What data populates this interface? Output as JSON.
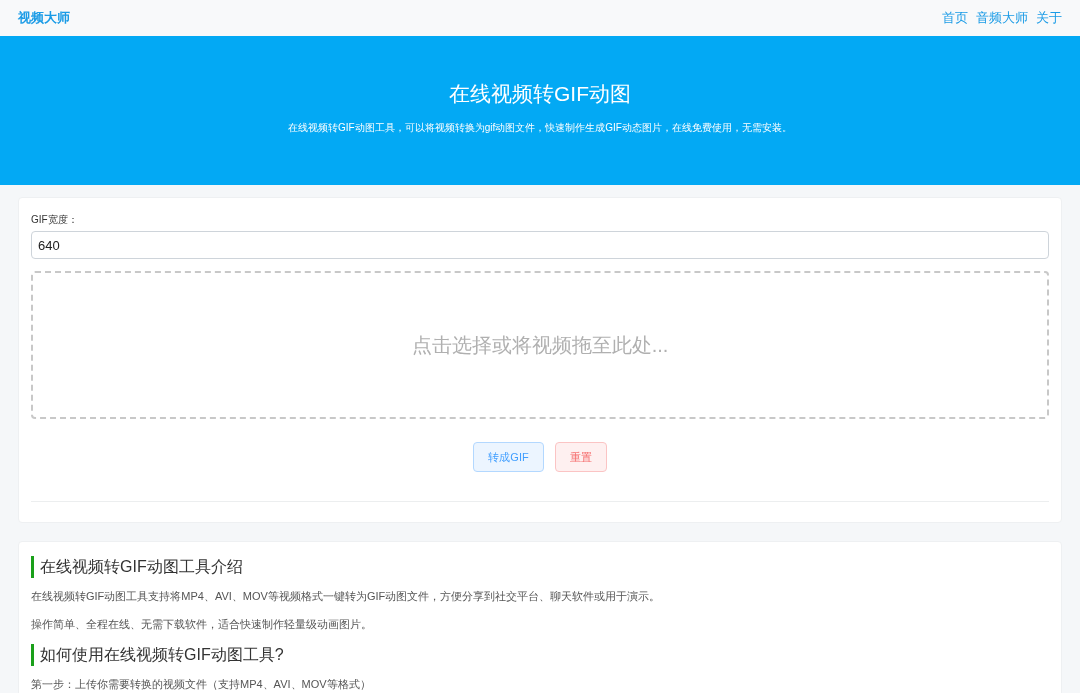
{
  "navbar": {
    "brand": "视频大师",
    "links": [
      "首页",
      "音频大师",
      "关于"
    ]
  },
  "hero": {
    "title": "在线视频转GIF动图",
    "subtitle": "在线视频转GIF动图工具，可以将视频转换为gif动图文件，快速制作生成GIF动态图片，在线免费使用，无需安装。"
  },
  "form": {
    "width_label": "GIF宽度：",
    "width_value": "640",
    "dropzone": "点击选择或将视频拖至此处...",
    "buttons": [
      {
        "label": "转成GIF",
        "kind": "primary"
      },
      {
        "label": "重置",
        "kind": "danger"
      }
    ]
  },
  "article": [
    {
      "kind": "heading",
      "text": "在线视频转GIF动图工具介绍"
    },
    {
      "kind": "paragraph",
      "text": "在线视频转GIF动图工具支持将MP4、AVI、MOV等视频格式一键转为GIF动图文件，方便分享到社交平台、聊天软件或用于演示。"
    },
    {
      "kind": "paragraph",
      "text": "操作简单、全程在线、无需下载软件，适合快速制作轻量级动画图片。"
    },
    {
      "kind": "heading",
      "text": "如何使用在线视频转GIF动图工具?"
    },
    {
      "kind": "paragraph",
      "text": "第一步：上传你需要转换的视频文件（支持MP4、AVI、MOV等格式）"
    }
  ]
}
